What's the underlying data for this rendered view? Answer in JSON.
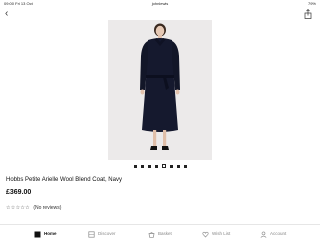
{
  "status_bar": {
    "time_date": "09:00  Fri 13 Oct",
    "url": "johnlewis",
    "right_status": "79%"
  },
  "product": {
    "title": "Hobbs Petite Arielle Wool Blend Coat, Navy",
    "price": "£369.00",
    "rating_stars": "☆☆☆☆☆",
    "reviews_text": "(No reviews)",
    "image_count": 8,
    "active_image_index": 4
  },
  "tabbar": {
    "items": [
      {
        "label": "Home",
        "icon": "home-icon",
        "active": true
      },
      {
        "label": "Discover",
        "icon": "discover-icon",
        "active": false
      },
      {
        "label": "Basket",
        "icon": "basket-icon",
        "active": false
      },
      {
        "label": "Wish List",
        "icon": "heart-icon",
        "active": false
      },
      {
        "label": "Account",
        "icon": "account-icon",
        "active": false
      }
    ]
  },
  "colors": {
    "coat": "#15192e",
    "background_photo": "#eceaea",
    "active_dot": "#222222"
  }
}
